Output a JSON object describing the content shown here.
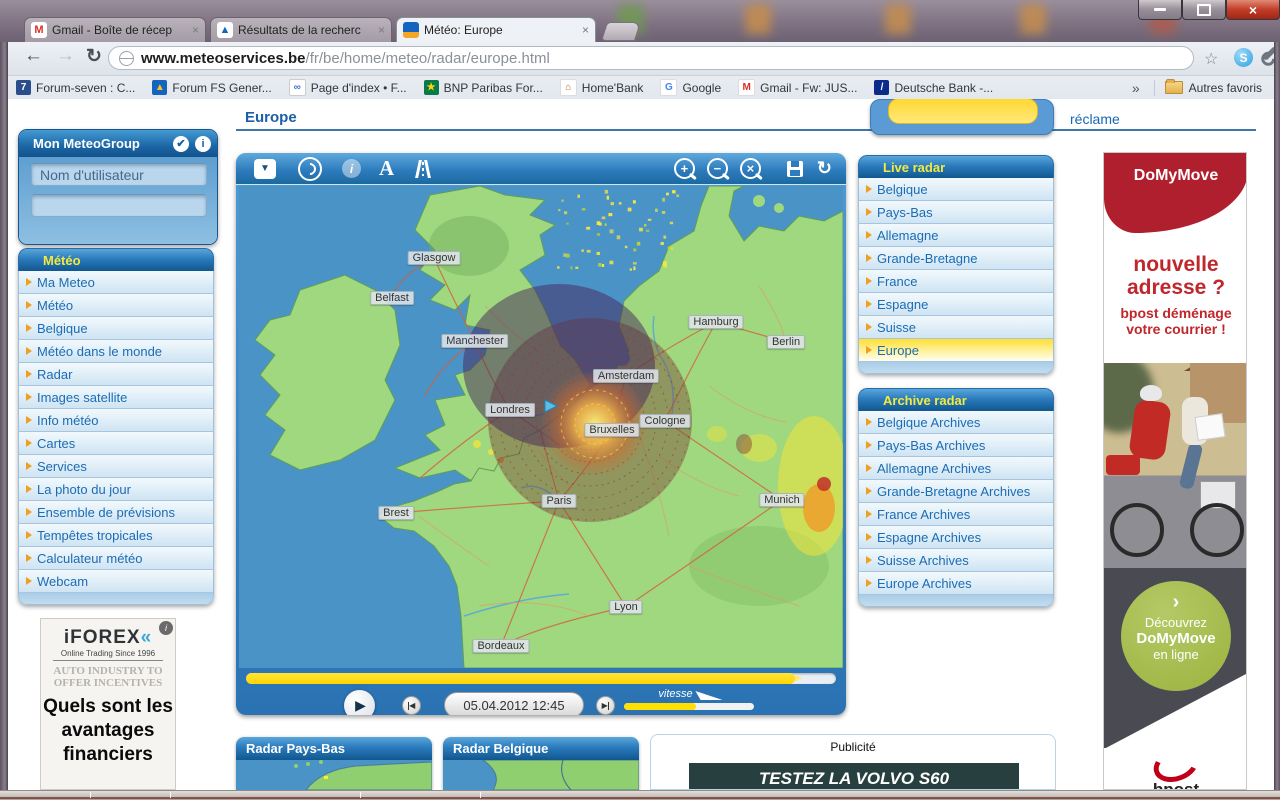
{
  "icons": {
    "tab_close": "×",
    "window_close": "×",
    "back_arrow": "←",
    "forward_arrow": "→",
    "reload_glyph": "↻",
    "star": "☆",
    "overflow_chevron": "»",
    "skype_glyph": "S",
    "dropdown": "▼",
    "info": "i",
    "map_label_a": "A",
    "zoom_in": "+",
    "zoom_out": "−",
    "zoom_reset": "×",
    "map_refresh": "↻",
    "check": "✔",
    "play": "▶",
    "step_back": "◀",
    "step_fwd": "▶",
    "scroll_up": "▲",
    "scroll_down": "▼",
    "cta_chevron": "›"
  },
  "browser": {
    "tabs": [
      {
        "title": "Gmail - Boîte de récep",
        "fav": "M"
      },
      {
        "title": "Résultats de la recherc",
        "fav": "▲"
      },
      {
        "title": "Météo: Europe",
        "fav": ""
      }
    ],
    "address": {
      "domain": "www.meteoservices.be",
      "path": "/fr/be/home/meteo/radar/europe.html"
    },
    "bookmarks": [
      {
        "label": "Forum-seven : C...",
        "glyph": "7"
      },
      {
        "label": "Forum FS Gener...",
        "glyph": "▲"
      },
      {
        "label": "Page d'index • F...",
        "glyph": "∞"
      },
      {
        "label": "BNP Paribas For...",
        "glyph": "★"
      },
      {
        "label": "Home'Bank",
        "glyph": "⌂"
      },
      {
        "label": "Google",
        "glyph": "G"
      },
      {
        "label": "Gmail - Fw: JUS...",
        "glyph": "M"
      },
      {
        "label": "Deutsche Bank -...",
        "glyph": "/"
      }
    ],
    "other_bookmarks": "Autres favoris"
  },
  "page": {
    "title": "Europe",
    "ad_link": "réclame",
    "login": {
      "title": "Mon MeteoGroup",
      "username_value": "Nom d'utilisateur"
    },
    "left_menu": {
      "title": "Météo",
      "items": [
        "Ma Meteo",
        "Météo",
        "Belgique",
        "Météo dans le monde",
        "Radar",
        "Images satellite",
        "Info météo",
        "Cartes",
        "Services",
        "La photo du jour",
        "Ensemble de prévisions",
        "Tempêtes tropicales",
        "Calculateur météo",
        "Webcam"
      ]
    },
    "live_radar": {
      "title": "Live radar",
      "items": [
        "Belgique",
        "Pays-Bas",
        "Allemagne",
        "Grande-Bretagne",
        "France",
        "Espagne",
        "Suisse",
        "Europe"
      ],
      "selected": "Europe"
    },
    "archive_radar": {
      "title": "Archive radar",
      "items": [
        "Belgique Archives",
        "Pays-Bas Archives",
        "Allemagne Archives",
        "Grande-Bretagne Archives",
        "France Archives",
        "Espagne Archives",
        "Suisse Archives",
        "Europe Archives"
      ]
    },
    "map": {
      "cities": [
        "Glasgow",
        "Belfast",
        "Manchester",
        "Hamburg",
        "Berlin",
        "Amsterdam",
        "Londres",
        "Bruxelles",
        "Cologne",
        "Paris",
        "Brest",
        "Munich",
        "Lyon",
        "Bordeaux"
      ],
      "player": {
        "datetime": "05.04.2012 12:45",
        "speed_label": "vitesse"
      }
    },
    "panels": {
      "nl": "Radar Pays-Bas",
      "be": "Radar Belgique",
      "ad_label": "Publicité",
      "ad_text": "TESTEZ LA VOLVO S60"
    },
    "iforex": {
      "brand": "iFOREX",
      "chevrons": "«",
      "tagline": "Online Trading Since 1996",
      "ghost1": "AUTO INDUSTRY TO",
      "ghost2": "OFFER INCENTIVES",
      "headline": "Quels sont les avantages financiers"
    },
    "domymove": {
      "brand": "DoMyMove",
      "headline": "nouvelle adresse ?",
      "subline": "bpost déménage votre courrier !",
      "cta_line1": "Découvrez",
      "cta_line2": "DoMyMove",
      "cta_line3": "en ligne",
      "footer_brand": "bpost"
    },
    "colors": {
      "accent_blue": "#1b6cb5",
      "header_yellow": "#f3ea3f",
      "selected_yellow": "#ffdf33",
      "ad_red": "#c0272d",
      "cta_green": "#9cb23e",
      "progress_yellow": "#ffe000",
      "sea": "#4a93c7",
      "land": "#a0d87f"
    }
  }
}
